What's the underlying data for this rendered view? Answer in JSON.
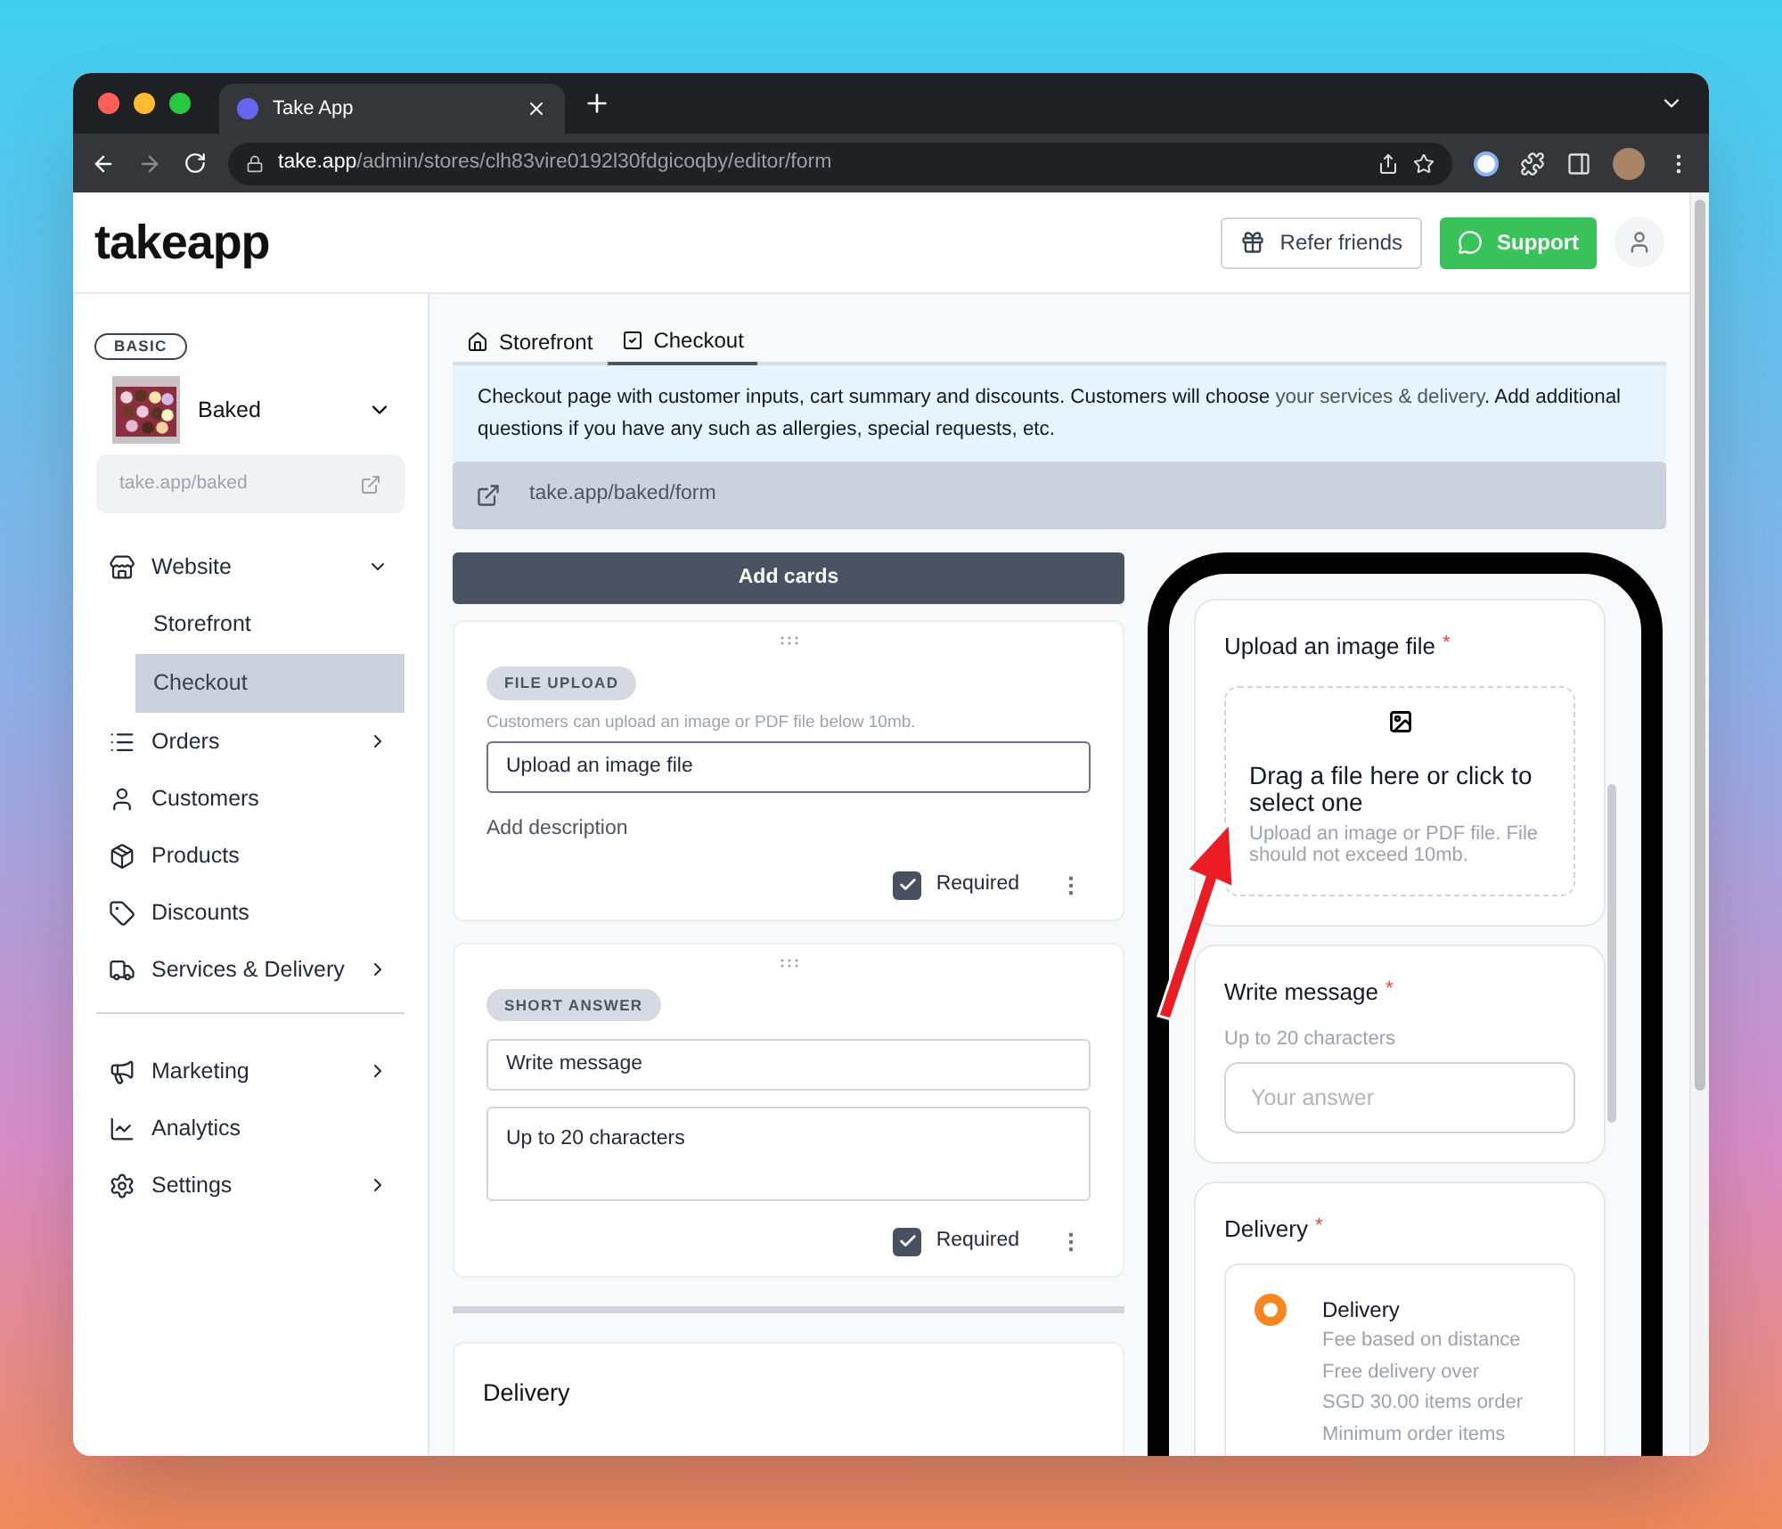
{
  "browser": {
    "tab_title": "Take App",
    "url_host": "take.app",
    "url_path": "/admin/stores/clh83vire0192l30fdgicoqby/editor/form"
  },
  "header": {
    "logo": "takeapp",
    "refer_button": "Refer friends",
    "support_button": "Support"
  },
  "sidebar": {
    "plan_badge": "BASIC",
    "store_name": "Baked",
    "store_link": "take.app/baked",
    "nav_groups": [
      [
        {
          "label": "Website",
          "expanded": true,
          "children": [
            {
              "label": "Storefront",
              "selected": false
            },
            {
              "label": "Checkout",
              "selected": true
            }
          ]
        },
        {
          "label": "Orders",
          "expanded": false
        },
        {
          "label": "Customers"
        },
        {
          "label": "Products"
        },
        {
          "label": "Discounts"
        },
        {
          "label": "Services & Delivery",
          "expanded": false
        }
      ],
      [
        {
          "label": "Marketing",
          "expanded": false
        },
        {
          "label": "Analytics"
        },
        {
          "label": "Settings",
          "expanded": false
        }
      ]
    ]
  },
  "tabs": [
    {
      "label": "Storefront",
      "selected": false
    },
    {
      "label": "Checkout",
      "selected": true
    }
  ],
  "info": {
    "before": "Checkout page with customer inputs, cart summary and discounts. Customers will choose ",
    "link": "your services & delivery",
    "after": ". Add additional questions if you have any such as allergies, special requests, etc."
  },
  "form_link": "take.app/baked/form",
  "add_cards_button": "Add cards",
  "cards": [
    {
      "badge": "FILE UPLOAD",
      "hint": "Customers can upload an image or PDF file below 10mb.",
      "title": "Upload an image file",
      "description_link": "Add description",
      "required_label": "Required",
      "required": true
    },
    {
      "badge": "SHORT ANSWER",
      "title": "Write message",
      "description": "Up to 20 characters",
      "required_label": "Required",
      "required": true
    }
  ],
  "delivery_card": {
    "title": "Delivery"
  },
  "preview": {
    "questions": [
      {
        "kind": "upload",
        "title": "Upload an image file",
        "required_mark": "*",
        "drop_text": "Drag a file here or click to select one",
        "drop_hint": "Upload an image or PDF file. File should not exceed 10mb."
      },
      {
        "kind": "text",
        "title": "Write message",
        "required_mark": "*",
        "hint": "Up to 20 characters",
        "placeholder": "Your answer"
      },
      {
        "kind": "choice",
        "title": "Delivery",
        "required_mark": "*",
        "options": [
          {
            "name": "Delivery",
            "selected": true,
            "lines": [
              "Fee based on distance",
              "Free delivery over",
              "SGD 30.00 items order",
              "Minimum order items"
            ]
          }
        ]
      }
    ]
  }
}
